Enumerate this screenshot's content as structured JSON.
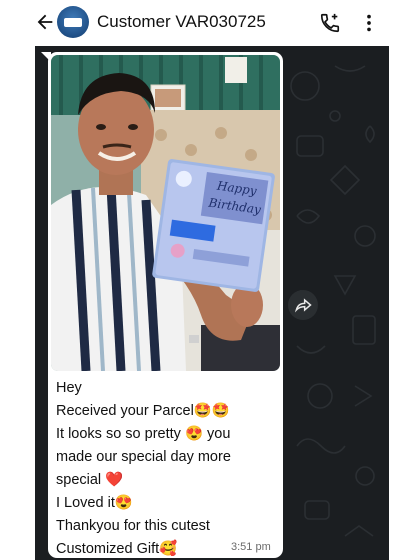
{
  "header": {
    "contact_name": "Customer VAR030725",
    "back_icon": "arrow-left-icon",
    "avatar_icon": "business-logo-avatar",
    "call_icon": "phone-plus-icon",
    "menu_icon": "more-vertical-icon"
  },
  "message": {
    "lines": [
      "Hey",
      "Received your Parcel🤩🤩",
      "It looks so so pretty 😍 you",
      "made our special day more",
      "special ❤️",
      "I Loved it😍",
      "Thankyou for this cutest",
      "Customized Gift🥰"
    ],
    "time": "3:51 pm"
  },
  "photo": {
    "card_line1": "Happy",
    "card_line2": "Birthday"
  },
  "colors": {
    "chat_background": "#1b1e21",
    "bubble": "#ffffff",
    "header": "#ffffff",
    "forward_button": "#2a2e31"
  }
}
